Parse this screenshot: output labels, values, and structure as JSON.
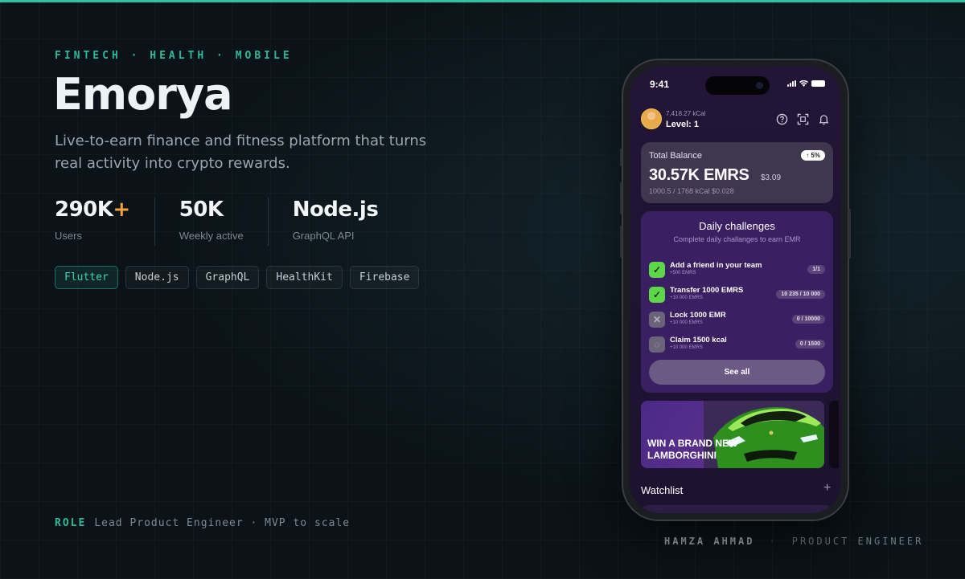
{
  "eyebrow": "FINTECH · HEALTH · MOBILE",
  "title": "Emorya",
  "subtitle": "Live-to-earn finance and fitness platform that turns real activity into crypto rewards.",
  "stats": [
    {
      "value": "290K",
      "suffix": "+",
      "label": "Users"
    },
    {
      "value": "50K",
      "label": "Weekly active"
    },
    {
      "value": "Node.js",
      "label": "GraphQL API"
    }
  ],
  "tech_chips": [
    {
      "label": "Flutter",
      "active": true
    },
    {
      "label": "Node.js",
      "active": false
    },
    {
      "label": "GraphQL",
      "active": false
    },
    {
      "label": "HealthKit",
      "active": false
    },
    {
      "label": "Firebase",
      "active": false
    }
  ],
  "role": {
    "key": "ROLE",
    "value": "Lead Product Engineer · MVP to scale"
  },
  "credit": {
    "name": "HAMZA AHMAD",
    "separator": "·",
    "title": "PRODUCT ENGINEER"
  },
  "phone": {
    "status_time": "9:41",
    "kcal": "7,418.27 kCal",
    "level": "Level: 1",
    "balance": {
      "label": "Total Balance",
      "badge": "↑ 5%",
      "value": "30.57K EMRS",
      "usd": "$3.09",
      "sub": "1000.5 / 1768 kCal $0.028"
    },
    "challenges": {
      "title": "Daily challenges",
      "subtitle": "Complete daily challanges to earn EMR",
      "items": [
        {
          "name": "Add a friend in your team",
          "reward": "+500 EMRS",
          "progress": "1/1",
          "done": true
        },
        {
          "name": "Transfer 1000 EMRS",
          "reward": "+10 000 EMRS",
          "progress": "10 235 / 10 000",
          "done": true
        },
        {
          "name": "Lock 1000 EMR",
          "reward": "+10 000 EMRS",
          "progress": "0 / 10000",
          "done": false
        },
        {
          "name": "Claim 1500 kcal",
          "reward": "+10 000 EMRS",
          "progress": "0 / 1500",
          "done": false
        }
      ],
      "see_all": "See all"
    },
    "promo_text": "WIN A BRAND NEW LAMBORGHINI",
    "watchlist_title": "Watchlist",
    "watchlist_add": "+"
  },
  "colors": {
    "accent": "#2bb89b",
    "background": "#0b1318",
    "phone_bg": "#221536",
    "challenge_done": "#5ed64a",
    "stat_plus": "#f0a23b"
  }
}
